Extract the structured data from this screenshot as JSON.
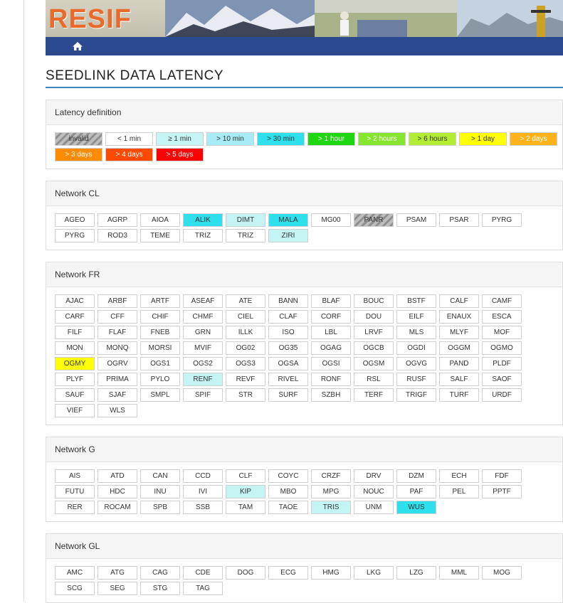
{
  "banner": {
    "logo_text": "RESIF"
  },
  "page_title": "SEEDLINK DATA LATENCY",
  "legend": {
    "title": "Latency definition",
    "items": [
      {
        "label": "invalid",
        "cls": "s-invalid"
      },
      {
        "label": "< 1 min",
        "cls": "s-lt1m"
      },
      {
        "label": "≥ 1 min",
        "cls": "s-ge1m"
      },
      {
        "label": "> 10 min",
        "cls": "s-10m"
      },
      {
        "label": "> 30 min",
        "cls": "s-30m"
      },
      {
        "label": "> 1 hour",
        "cls": "s-1h"
      },
      {
        "label": "> 2 hours",
        "cls": "s-2h"
      },
      {
        "label": "> 6 hours",
        "cls": "s-6h"
      },
      {
        "label": "> 1 day",
        "cls": "s-1d"
      },
      {
        "label": "> 2 days",
        "cls": "s-2d"
      },
      {
        "label": "> 3 days",
        "cls": "s-3d"
      },
      {
        "label": "> 4 days",
        "cls": "s-4d"
      },
      {
        "label": "> 5 days",
        "cls": "s-5d"
      }
    ]
  },
  "networks": [
    {
      "title": "Network CL",
      "stations": [
        {
          "code": "AGEO",
          "s": "s-lt1m"
        },
        {
          "code": "AGRP",
          "s": "s-lt1m"
        },
        {
          "code": "AIOA",
          "s": "s-lt1m"
        },
        {
          "code": "ALIK",
          "s": "s-30m"
        },
        {
          "code": "DIMT",
          "s": "s-ge1m"
        },
        {
          "code": "MALA",
          "s": "s-30m"
        },
        {
          "code": "MG00",
          "s": "s-lt1m"
        },
        {
          "code": "PANR",
          "s": "s-invalid"
        },
        {
          "code": "PSAM",
          "s": "s-lt1m"
        },
        {
          "code": "PSAR",
          "s": "s-lt1m"
        },
        {
          "code": "PYRG",
          "s": "s-lt1m"
        },
        {
          "code": "PYRG",
          "s": "s-lt1m"
        },
        {
          "code": "ROD3",
          "s": "s-lt1m"
        },
        {
          "code": "TEME",
          "s": "s-lt1m"
        },
        {
          "code": "TRIZ",
          "s": "s-lt1m"
        },
        {
          "code": "TRIZ",
          "s": "s-lt1m"
        },
        {
          "code": "ZIRI",
          "s": "s-ge1m"
        }
      ]
    },
    {
      "title": "Network FR",
      "stations": [
        {
          "code": "AJAC",
          "s": "s-lt1m"
        },
        {
          "code": "ARBF",
          "s": "s-lt1m"
        },
        {
          "code": "ARTF",
          "s": "s-lt1m"
        },
        {
          "code": "ASEAF",
          "s": "s-lt1m"
        },
        {
          "code": "ATE",
          "s": "s-lt1m"
        },
        {
          "code": "BANN",
          "s": "s-lt1m"
        },
        {
          "code": "BLAF",
          "s": "s-lt1m"
        },
        {
          "code": "BOUC",
          "s": "s-lt1m"
        },
        {
          "code": "BSTF",
          "s": "s-lt1m"
        },
        {
          "code": "CALF",
          "s": "s-lt1m"
        },
        {
          "code": "CAMF",
          "s": "s-lt1m"
        },
        {
          "code": "CARF",
          "s": "s-lt1m"
        },
        {
          "code": "CFF",
          "s": "s-lt1m"
        },
        {
          "code": "CHIF",
          "s": "s-lt1m"
        },
        {
          "code": "CHMF",
          "s": "s-lt1m"
        },
        {
          "code": "CIEL",
          "s": "s-lt1m"
        },
        {
          "code": "CLAF",
          "s": "s-lt1m"
        },
        {
          "code": "CORF",
          "s": "s-lt1m"
        },
        {
          "code": "DOU",
          "s": "s-lt1m"
        },
        {
          "code": "EILF",
          "s": "s-lt1m"
        },
        {
          "code": "ENAUX",
          "s": "s-lt1m"
        },
        {
          "code": "ESCA",
          "s": "s-lt1m"
        },
        {
          "code": "FILF",
          "s": "s-lt1m"
        },
        {
          "code": "FLAF",
          "s": "s-lt1m"
        },
        {
          "code": "FNEB",
          "s": "s-lt1m"
        },
        {
          "code": "GRN",
          "s": "s-lt1m"
        },
        {
          "code": "ILLK",
          "s": "s-lt1m"
        },
        {
          "code": "ISO",
          "s": "s-lt1m"
        },
        {
          "code": "LBL",
          "s": "s-lt1m"
        },
        {
          "code": "LRVF",
          "s": "s-lt1m"
        },
        {
          "code": "MLS",
          "s": "s-lt1m"
        },
        {
          "code": "MLYF",
          "s": "s-lt1m"
        },
        {
          "code": "MOF",
          "s": "s-lt1m"
        },
        {
          "code": "MON",
          "s": "s-lt1m"
        },
        {
          "code": "MONQ",
          "s": "s-lt1m"
        },
        {
          "code": "MORSI",
          "s": "s-lt1m"
        },
        {
          "code": "MVIF",
          "s": "s-lt1m"
        },
        {
          "code": "OG02",
          "s": "s-lt1m"
        },
        {
          "code": "OG35",
          "s": "s-lt1m"
        },
        {
          "code": "OGAG",
          "s": "s-lt1m"
        },
        {
          "code": "OGCB",
          "s": "s-lt1m"
        },
        {
          "code": "OGDI",
          "s": "s-lt1m"
        },
        {
          "code": "OGGM",
          "s": "s-lt1m"
        },
        {
          "code": "OGMO",
          "s": "s-lt1m"
        },
        {
          "code": "OGMY",
          "s": "s-1d"
        },
        {
          "code": "OGRV",
          "s": "s-lt1m"
        },
        {
          "code": "OGS1",
          "s": "s-lt1m"
        },
        {
          "code": "OGS2",
          "s": "s-lt1m"
        },
        {
          "code": "OGS3",
          "s": "s-lt1m"
        },
        {
          "code": "OGSA",
          "s": "s-lt1m"
        },
        {
          "code": "OGSI",
          "s": "s-lt1m"
        },
        {
          "code": "OGSM",
          "s": "s-lt1m"
        },
        {
          "code": "OGVG",
          "s": "s-lt1m"
        },
        {
          "code": "PAND",
          "s": "s-lt1m"
        },
        {
          "code": "PLDF",
          "s": "s-lt1m"
        },
        {
          "code": "PLYF",
          "s": "s-lt1m"
        },
        {
          "code": "PRIMA",
          "s": "s-lt1m"
        },
        {
          "code": "PYLO",
          "s": "s-lt1m"
        },
        {
          "code": "RENF",
          "s": "s-ge1m"
        },
        {
          "code": "REVF",
          "s": "s-lt1m"
        },
        {
          "code": "RIVEL",
          "s": "s-lt1m"
        },
        {
          "code": "RONF",
          "s": "s-lt1m"
        },
        {
          "code": "RSL",
          "s": "s-lt1m"
        },
        {
          "code": "RUSF",
          "s": "s-lt1m"
        },
        {
          "code": "SALF",
          "s": "s-lt1m"
        },
        {
          "code": "SAOF",
          "s": "s-lt1m"
        },
        {
          "code": "SAUF",
          "s": "s-lt1m"
        },
        {
          "code": "SJAF",
          "s": "s-lt1m"
        },
        {
          "code": "SMPL",
          "s": "s-lt1m"
        },
        {
          "code": "SPIF",
          "s": "s-lt1m"
        },
        {
          "code": "STR",
          "s": "s-lt1m"
        },
        {
          "code": "SURF",
          "s": "s-lt1m"
        },
        {
          "code": "SZBH",
          "s": "s-lt1m"
        },
        {
          "code": "TERF",
          "s": "s-lt1m"
        },
        {
          "code": "TRIGF",
          "s": "s-lt1m"
        },
        {
          "code": "TURF",
          "s": "s-lt1m"
        },
        {
          "code": "URDF",
          "s": "s-lt1m"
        },
        {
          "code": "VIEF",
          "s": "s-lt1m"
        },
        {
          "code": "WLS",
          "s": "s-lt1m"
        }
      ]
    },
    {
      "title": "Network G",
      "stations": [
        {
          "code": "AIS",
          "s": "s-lt1m"
        },
        {
          "code": "ATD",
          "s": "s-lt1m"
        },
        {
          "code": "CAN",
          "s": "s-lt1m"
        },
        {
          "code": "CCD",
          "s": "s-lt1m"
        },
        {
          "code": "CLF",
          "s": "s-lt1m"
        },
        {
          "code": "COYC",
          "s": "s-lt1m"
        },
        {
          "code": "CRZF",
          "s": "s-lt1m"
        },
        {
          "code": "DRV",
          "s": "s-lt1m"
        },
        {
          "code": "DZM",
          "s": "s-lt1m"
        },
        {
          "code": "ECH",
          "s": "s-lt1m"
        },
        {
          "code": "FDF",
          "s": "s-lt1m"
        },
        {
          "code": "FUTU",
          "s": "s-lt1m"
        },
        {
          "code": "HDC",
          "s": "s-lt1m"
        },
        {
          "code": "INU",
          "s": "s-lt1m"
        },
        {
          "code": "IVI",
          "s": "s-lt1m"
        },
        {
          "code": "KIP",
          "s": "s-ge1m"
        },
        {
          "code": "MBO",
          "s": "s-lt1m"
        },
        {
          "code": "MPG",
          "s": "s-lt1m"
        },
        {
          "code": "NOUC",
          "s": "s-lt1m"
        },
        {
          "code": "PAF",
          "s": "s-lt1m"
        },
        {
          "code": "PEL",
          "s": "s-lt1m"
        },
        {
          "code": "PPTF",
          "s": "s-lt1m"
        },
        {
          "code": "RER",
          "s": "s-lt1m"
        },
        {
          "code": "ROCAM",
          "s": "s-lt1m"
        },
        {
          "code": "SPB",
          "s": "s-lt1m"
        },
        {
          "code": "SSB",
          "s": "s-lt1m"
        },
        {
          "code": "TAM",
          "s": "s-lt1m"
        },
        {
          "code": "TAOE",
          "s": "s-lt1m"
        },
        {
          "code": "TRIS",
          "s": "s-ge1m"
        },
        {
          "code": "UNM",
          "s": "s-lt1m"
        },
        {
          "code": "WUS",
          "s": "s-30m"
        }
      ]
    },
    {
      "title": "Network GL",
      "stations": [
        {
          "code": "AMC",
          "s": "s-lt1m"
        },
        {
          "code": "ATG",
          "s": "s-lt1m"
        },
        {
          "code": "CAG",
          "s": "s-lt1m"
        },
        {
          "code": "CDE",
          "s": "s-lt1m"
        },
        {
          "code": "DOG",
          "s": "s-lt1m"
        },
        {
          "code": "ECG",
          "s": "s-lt1m"
        },
        {
          "code": "HMG",
          "s": "s-lt1m"
        },
        {
          "code": "LKG",
          "s": "s-lt1m"
        },
        {
          "code": "LZG",
          "s": "s-lt1m"
        },
        {
          "code": "MML",
          "s": "s-lt1m"
        },
        {
          "code": "MOG",
          "s": "s-lt1m"
        },
        {
          "code": "SCG",
          "s": "s-lt1m"
        },
        {
          "code": "SEG",
          "s": "s-lt1m"
        },
        {
          "code": "STG",
          "s": "s-lt1m"
        },
        {
          "code": "TAG",
          "s": "s-lt1m"
        }
      ]
    }
  ]
}
